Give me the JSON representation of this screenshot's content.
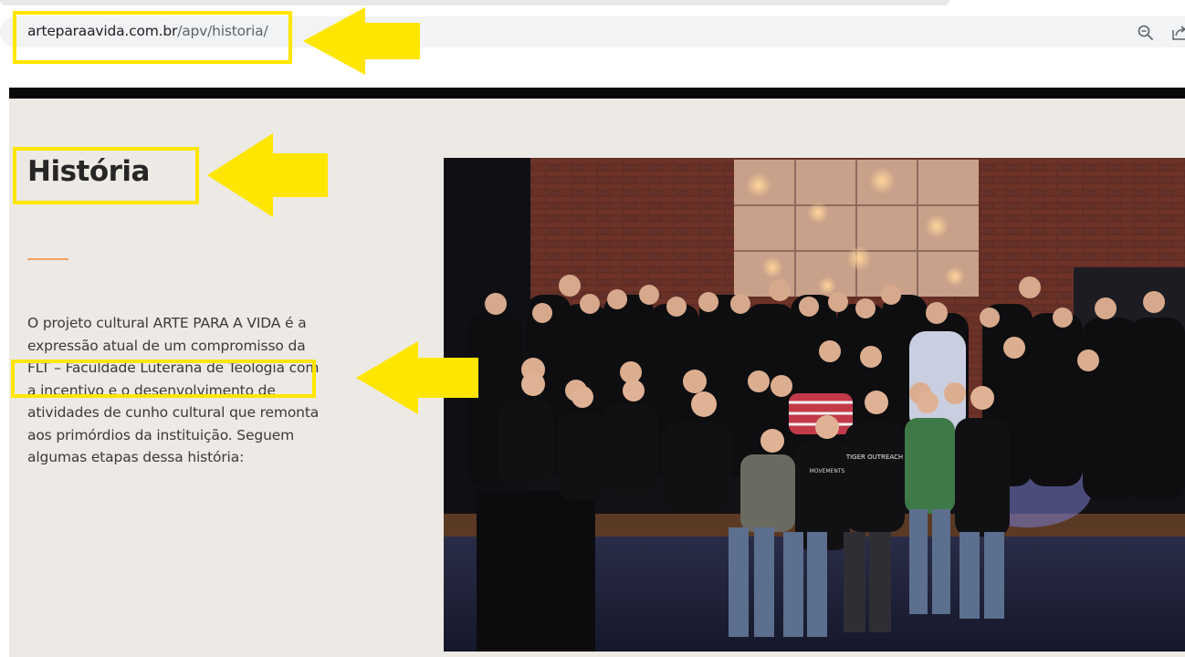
{
  "browser": {
    "url_domain": "arteparaavida.com.br",
    "url_path": "/apv/historia/",
    "zoom_icon": "magnifier-minus-icon",
    "share_icon": "share-icon"
  },
  "page": {
    "title": "História",
    "paragraph_lines": [
      "O projeto cultural ARTE PARA A VIDA é a",
      "expressão atual de um compromisso da",
      "FLT – Faculdade Luterana de Teologia com",
      "a incentivo e o desenvolvimento de",
      "atividades de cunho cultural que remonta",
      "aos primórdios da instituição. Seguem",
      "algumas etapas dessa história:"
    ],
    "photo": "group-photo-on-stage",
    "shirt_texts": [
      "TIGER OUTREACH",
      "MOVEMENTS"
    ]
  },
  "annotations": {
    "highlight_color": "#ffe600",
    "accent_color": "#f0a35e",
    "arrow_icon": "left-arrow-icon"
  }
}
